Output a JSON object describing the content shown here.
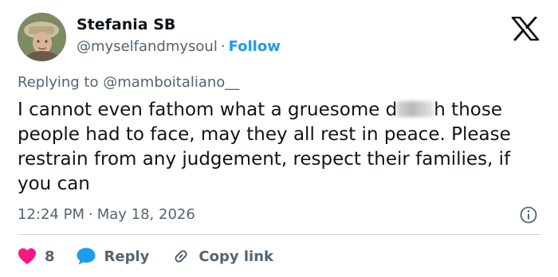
{
  "user": {
    "display_name": "Stefania SB",
    "handle": "@myselfandmysoul",
    "separator": "·",
    "follow_label": "Follow"
  },
  "replying": {
    "prefix": "Replying to",
    "mention": "@mamboitaliano__"
  },
  "tweet": {
    "text_before_censor": "I cannot even fathom what a gruesome d",
    "text_after_censor": "h those people had to face, may they all rest in peace. Please restrain from any judgement, respect their families, if you can"
  },
  "meta": {
    "time": "12:24 PM",
    "separator": "·",
    "date": "May 18, 2026"
  },
  "actions": {
    "likes_count": "8",
    "reply_label": "Reply",
    "copy_link_label": "Copy link"
  },
  "colors": {
    "like": "#f91880",
    "reply": "#1d9bf0",
    "link": "#1d9bf0",
    "secondary_text": "#536471",
    "primary_text": "#0f1419",
    "divider": "#cfd9de"
  },
  "icons": {
    "logo": "x-logo-icon",
    "info": "info-icon",
    "like": "heart-icon",
    "reply": "speech-bubble-icon",
    "copy": "link-icon"
  }
}
